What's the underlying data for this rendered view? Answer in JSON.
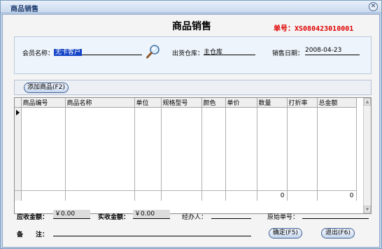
{
  "window": {
    "title": "商品销售",
    "close_label": "✕"
  },
  "header": {
    "title": "商品销售",
    "order_label": "单号：",
    "order_no": "XS080423010001"
  },
  "info": {
    "member_label": "会员名称：",
    "member_value": "无卡客户",
    "warehouse_label": "出货仓库：",
    "warehouse_value": "主仓库",
    "date_label": "销售日期：",
    "date_value": "2008-04-23"
  },
  "toolbar": {
    "add_label": "添加商品(F2)"
  },
  "grid": {
    "columns": [
      "商品编号",
      "商品名称",
      "单位",
      "规格型号",
      "颜色",
      "单价",
      "数量",
      "打折率",
      "总金额"
    ],
    "totals": {
      "quantity": "0",
      "amount": "0"
    }
  },
  "footer": {
    "receivable_label": "应收金额：",
    "receivable_value": "￥0.00",
    "received_label": "实收金额：",
    "received_value": "￥0.00",
    "handler_label": "经办人：",
    "original_label": "原始单号：",
    "remark_label": "备　　注：",
    "ok_label": "确定(F5)",
    "exit_label": "退出(F6)"
  }
}
